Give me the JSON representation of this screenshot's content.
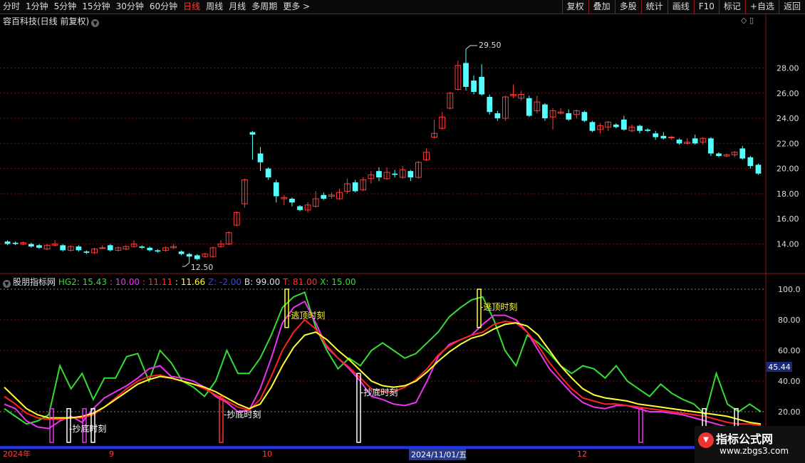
{
  "toolbar": {
    "left_items": [
      "分时",
      "1分钟",
      "5分钟",
      "15分钟",
      "30分钟",
      "60分钟",
      "日线",
      "周线",
      "月线",
      "多周期",
      "更多 >"
    ],
    "active": "日线",
    "right_items": [
      "复权",
      "叠加",
      "多股",
      "统计",
      "画线",
      "F10",
      "标记",
      "+自选",
      "返回"
    ]
  },
  "stock": {
    "title": "容百科技(日线 前复权)",
    "high_label": "29.50",
    "low_label": "12.50"
  },
  "price_axis": [
    "28.00",
    "26.00",
    "24.00",
    "22.00",
    "20.00",
    "18.00",
    "16.00",
    "14.00"
  ],
  "indicator": {
    "name": "股朋指标网",
    "items": [
      {
        "label": "HG2: 15.43",
        "color": "#33dd33"
      },
      {
        "label": ": 10.00",
        "color": "#ee33ee"
      },
      {
        "label": ": 11.11",
        "color": "#ff3333"
      },
      {
        "label": ": 11.66",
        "color": "#ffff33"
      },
      {
        "label": "Z: -2.00",
        "color": "#3344ff"
      },
      {
        "label": "B: 99.00",
        "color": "#dddddd"
      },
      {
        "label": "T: 81.00",
        "color": "#ff3333"
      },
      {
        "label": "X: 15.00",
        "color": "#33dd33"
      }
    ],
    "axis": [
      "100.0",
      "80.00",
      "60.00",
      "40.00",
      "20.00"
    ],
    "current_value": "45.44"
  },
  "signals": {
    "buy": "抄底时刻",
    "sell": "逃顶时刻"
  },
  "date_axis": {
    "labels": [
      "2024年",
      "9",
      "10",
      "12"
    ],
    "cursor": "2024/11/01/五"
  },
  "watermark": {
    "line1": "指标公式网",
    "line2": "www.zbgs3.com"
  },
  "colors": {
    "up": "#ff3c3c",
    "down": "#54ffff",
    "frame": "#8b1a1a",
    "green": "#33dd33",
    "magenta": "#ee33ee",
    "red": "#ff2222",
    "yellow": "#ffff33"
  },
  "chart_data": [
    {
      "type": "candlestick",
      "title": "容百科技(日线 前复权)",
      "ylim": [
        12.5,
        29.5
      ],
      "candles": [
        [
          14.2,
          14.0,
          14.3,
          13.9
        ],
        [
          14.1,
          14.0,
          14.2,
          13.9
        ],
        [
          14.0,
          14.1,
          14.2,
          13.9
        ],
        [
          14.0,
          13.8,
          14.1,
          13.7
        ],
        [
          13.9,
          13.7,
          14.0,
          13.6
        ],
        [
          13.6,
          13.9,
          14.0,
          13.5
        ],
        [
          13.9,
          14.0,
          14.3,
          13.8
        ],
        [
          13.9,
          13.5,
          14.0,
          13.4
        ],
        [
          13.5,
          13.8,
          13.9,
          13.4
        ],
        [
          13.8,
          13.5,
          13.9,
          13.4
        ],
        [
          13.4,
          13.3,
          13.5,
          13.2
        ],
        [
          13.3,
          13.6,
          13.7,
          13.2
        ],
        [
          13.7,
          13.7,
          13.9,
          13.6
        ],
        [
          13.9,
          13.5,
          14.0,
          13.4
        ],
        [
          13.5,
          13.7,
          13.8,
          13.4
        ],
        [
          13.6,
          13.8,
          13.9,
          13.5
        ],
        [
          13.8,
          14.0,
          14.3,
          13.7
        ],
        [
          13.8,
          13.7,
          13.9,
          13.6
        ],
        [
          13.7,
          13.5,
          13.8,
          13.4
        ],
        [
          13.5,
          13.4,
          13.6,
          13.3
        ],
        [
          13.5,
          13.7,
          13.8,
          13.4
        ],
        [
          13.7,
          13.8,
          14.0,
          13.6
        ],
        [
          13.4,
          13.2,
          13.5,
          13.1
        ],
        [
          13.2,
          13.0,
          13.3,
          12.5
        ],
        [
          13.1,
          12.8,
          13.2,
          12.7
        ],
        [
          13.0,
          13.2,
          13.3,
          12.9
        ],
        [
          13.0,
          13.7,
          13.8,
          12.9
        ],
        [
          13.8,
          14.0,
          14.3,
          13.7
        ],
        [
          14.0,
          14.9,
          15.0,
          13.9
        ],
        [
          15.5,
          16.5,
          16.6,
          15.4
        ],
        [
          17.2,
          19.1,
          19.2,
          16.9
        ],
        [
          22.9,
          22.7,
          23.0,
          20.7
        ],
        [
          21.2,
          20.5,
          21.7,
          19.8
        ],
        [
          20.0,
          19.3,
          20.1,
          19.1
        ],
        [
          18.9,
          17.8,
          19.1,
          17.3
        ],
        [
          17.6,
          17.7,
          17.9,
          17.1
        ],
        [
          17.6,
          17.3,
          17.7,
          17.0
        ],
        [
          17.0,
          16.7,
          17.1,
          16.6
        ],
        [
          16.7,
          17.1,
          17.3,
          16.5
        ],
        [
          17.0,
          17.6,
          18.2,
          16.9
        ],
        [
          17.9,
          17.6,
          18.1,
          17.5
        ],
        [
          17.8,
          17.9,
          18.1,
          17.6
        ],
        [
          17.6,
          18.1,
          18.4,
          17.5
        ],
        [
          18.2,
          18.8,
          19.2,
          18.0
        ],
        [
          18.9,
          18.2,
          19.1,
          18.1
        ],
        [
          18.3,
          19.1,
          19.3,
          18.2
        ],
        [
          19.2,
          19.5,
          19.8,
          18.8
        ],
        [
          19.8,
          19.3,
          20.1,
          19.0
        ],
        [
          19.2,
          19.7,
          20.1,
          19.1
        ],
        [
          19.6,
          19.5,
          19.9,
          19.3
        ],
        [
          19.3,
          19.9,
          20.2,
          19.2
        ],
        [
          19.8,
          19.3,
          19.9,
          19.0
        ],
        [
          19.3,
          20.5,
          20.6,
          19.2
        ],
        [
          20.7,
          21.3,
          21.6,
          20.6
        ],
        [
          22.5,
          22.8,
          23.9,
          22.4
        ],
        [
          23.2,
          24.1,
          24.5,
          23.1
        ],
        [
          24.8,
          26.0,
          26.1,
          24.7
        ],
        [
          26.3,
          28.2,
          28.6,
          26.2
        ],
        [
          28.4,
          26.5,
          29.5,
          26.2
        ],
        [
          27.0,
          26.1,
          27.4,
          25.9
        ],
        [
          27.3,
          25.9,
          28.3,
          25.8
        ],
        [
          25.7,
          24.5,
          25.9,
          24.3
        ],
        [
          24.4,
          24.0,
          24.6,
          23.8
        ],
        [
          24.0,
          25.7,
          25.8,
          23.8
        ],
        [
          25.8,
          25.9,
          26.7,
          25.6
        ],
        [
          25.6,
          25.9,
          26.2,
          25.4
        ],
        [
          25.6,
          24.2,
          25.8,
          24.1
        ],
        [
          24.6,
          25.3,
          25.8,
          24.4
        ],
        [
          25.1,
          24.0,
          25.2,
          23.8
        ],
        [
          24.1,
          24.6,
          24.8,
          23.1
        ],
        [
          24.4,
          24.5,
          24.8,
          24.3
        ],
        [
          24.4,
          23.9,
          24.7,
          23.8
        ],
        [
          24.3,
          24.6,
          24.7,
          24.0
        ],
        [
          24.5,
          23.8,
          24.6,
          23.7
        ],
        [
          23.7,
          23.0,
          23.8,
          22.9
        ],
        [
          23.1,
          23.4,
          23.6,
          22.8
        ],
        [
          23.3,
          23.7,
          23.8,
          23.0
        ],
        [
          23.5,
          23.3,
          23.6,
          23.2
        ],
        [
          23.9,
          23.1,
          24.2,
          23.0
        ],
        [
          23.0,
          23.3,
          23.5,
          22.9
        ],
        [
          23.4,
          23.0,
          23.5,
          22.8
        ],
        [
          23.1,
          23.0,
          23.2,
          22.9
        ],
        [
          22.8,
          22.5,
          23.0,
          22.3
        ],
        [
          22.6,
          22.4,
          22.9,
          22.3
        ],
        [
          22.5,
          22.5,
          22.6,
          22.3
        ],
        [
          22.3,
          22.0,
          22.4,
          21.9
        ],
        [
          22.0,
          22.1,
          22.4,
          21.9
        ],
        [
          22.4,
          22.0,
          22.7,
          21.9
        ],
        [
          22.1,
          22.4,
          22.5,
          21.9
        ],
        [
          22.4,
          21.2,
          22.5,
          21.0
        ],
        [
          21.2,
          21.0,
          21.3,
          20.9
        ],
        [
          21.0,
          21.1,
          21.2,
          20.9
        ],
        [
          21.1,
          21.3,
          21.4,
          20.9
        ],
        [
          21.6,
          20.8,
          21.8,
          20.7
        ],
        [
          20.9,
          20.2,
          21.0,
          20.0
        ],
        [
          20.3,
          19.6,
          20.4,
          19.5
        ]
      ]
    },
    {
      "type": "line",
      "title": "股朋指标网",
      "ylim": [
        0,
        100
      ],
      "series": [
        {
          "name": "HG2",
          "color": "#33dd33",
          "values": [
            22,
            17,
            12,
            14,
            18,
            50,
            35,
            45,
            28,
            42,
            42,
            56,
            58,
            40,
            60,
            52,
            40,
            36,
            30,
            40,
            60,
            45,
            45,
            55,
            70,
            88,
            95,
            98,
            75,
            60,
            48,
            55,
            50,
            60,
            65,
            60,
            55,
            58,
            65,
            72,
            82,
            88,
            93,
            95,
            80,
            60,
            50,
            70,
            65,
            58,
            50,
            45,
            50,
            48,
            42,
            50,
            40,
            35,
            30,
            38,
            32,
            28,
            25,
            18,
            45,
            25,
            20,
            25,
            20
          ]
        },
        {
          "name": "",
          "color": "#ee33ee",
          "values": [
            25,
            22,
            14,
            10,
            9,
            14,
            17,
            13,
            22,
            29,
            33,
            37,
            42,
            48,
            50,
            43,
            42,
            40,
            36,
            30,
            26,
            20,
            21,
            35,
            55,
            78,
            88,
            92,
            78,
            62,
            55,
            48,
            40,
            30,
            28,
            25,
            24,
            26,
            40,
            56,
            64,
            67,
            70,
            77,
            83,
            83,
            80,
            72,
            60,
            48,
            40,
            32,
            26,
            23,
            22,
            24,
            24,
            22,
            20,
            20,
            19,
            18,
            16,
            14,
            12,
            10,
            10,
            10,
            10
          ]
        },
        {
          "name": "",
          "color": "#ff2222",
          "values": [
            30,
            25,
            19,
            16,
            15,
            15,
            16,
            16,
            18,
            23,
            29,
            35,
            40,
            43,
            44,
            42,
            40,
            38,
            35,
            31,
            27,
            23,
            21,
            28,
            43,
            60,
            72,
            80,
            74,
            63,
            55,
            49,
            42,
            35,
            33,
            33,
            36,
            41,
            48,
            57,
            63,
            67,
            70,
            72,
            77,
            79,
            78,
            72,
            63,
            52,
            43,
            35,
            29,
            27,
            25,
            25,
            24,
            23,
            22,
            21,
            20,
            19,
            18,
            17,
            15,
            13,
            12,
            12,
            11
          ]
        },
        {
          "name": "",
          "color": "#ffff33",
          "values": [
            36,
            29,
            22,
            18,
            16,
            16,
            16,
            17,
            19,
            23,
            28,
            33,
            38,
            41,
            43,
            42,
            40,
            38,
            36,
            33,
            29,
            25,
            22,
            25,
            36,
            50,
            62,
            70,
            72,
            67,
            60,
            54,
            47,
            40,
            37,
            36,
            37,
            40,
            46,
            53,
            59,
            64,
            68,
            70,
            74,
            77,
            78,
            76,
            70,
            60,
            50,
            42,
            35,
            31,
            29,
            28,
            27,
            25,
            24,
            23,
            22,
            21,
            20,
            19,
            18,
            17,
            15,
            13,
            12
          ]
        }
      ]
    }
  ]
}
